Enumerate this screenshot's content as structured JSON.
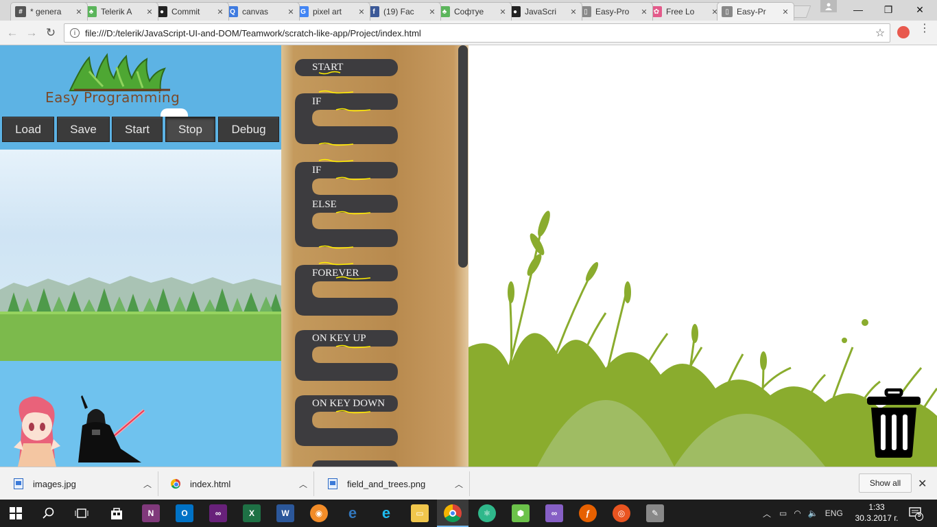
{
  "browser": {
    "tabs": [
      {
        "title": "* genera",
        "favicon_color": "#555555",
        "favicon_glyph": "#"
      },
      {
        "title": "Telerik A",
        "favicon_color": "#5bb55b",
        "favicon_glyph": "♣"
      },
      {
        "title": "Commit",
        "favicon_color": "#222222",
        "favicon_glyph": "●"
      },
      {
        "title": "canvas",
        "favicon_color": "#3f7be0",
        "favicon_glyph": "Q"
      },
      {
        "title": "pixel art",
        "favicon_color": "#4285f4",
        "favicon_glyph": "G"
      },
      {
        "title": "(19) Fac",
        "favicon_color": "#3b5998",
        "favicon_glyph": "f"
      },
      {
        "title": "Софтуе",
        "favicon_color": "#5bb55b",
        "favicon_glyph": "♣"
      },
      {
        "title": "JavaScri",
        "favicon_color": "#222222",
        "favicon_glyph": "●"
      },
      {
        "title": "Easy-Pro",
        "favicon_color": "#888888",
        "favicon_glyph": "▯"
      },
      {
        "title": "Free Lo",
        "favicon_color": "#e35a8a",
        "favicon_glyph": "✿"
      },
      {
        "title": "Easy-Pr",
        "favicon_color": "#888888",
        "favicon_glyph": "▯",
        "active": true
      }
    ],
    "url": "file:///D:/telerik/JavaScript-UI-and-DOM/Teamwork/scratch-like-app/Project/index.html",
    "icons": {
      "back": "back-arrow-icon",
      "forward": "forward-arrow-icon",
      "reload": "reload-icon",
      "info": "info-icon",
      "star": "star-icon",
      "menu": "menu-icon"
    }
  },
  "app": {
    "logo_text": "Easy Programming",
    "buttons": {
      "load": "Load",
      "save": "Save",
      "start": "Start",
      "stop": "Stop",
      "debug": "Debug"
    },
    "blocks": {
      "start": "START",
      "if": "IF",
      "if_else_if": "IF",
      "else": "ELSE",
      "forever": "FOREVER",
      "on_key_up": "ON KEY UP",
      "on_key_down": "ON KEY DOWN"
    },
    "block_color": "#3d3c3f",
    "accent_color": "#ffee00"
  },
  "downloads": {
    "items": [
      {
        "name": "images.jpg"
      },
      {
        "name": "index.html"
      },
      {
        "name": "field_and_trees.png"
      }
    ],
    "show_all": "Show all"
  },
  "taskbar": {
    "lang": "ENG",
    "time": "1:33",
    "date": "30.3.2017 г.",
    "notifications": "5"
  }
}
